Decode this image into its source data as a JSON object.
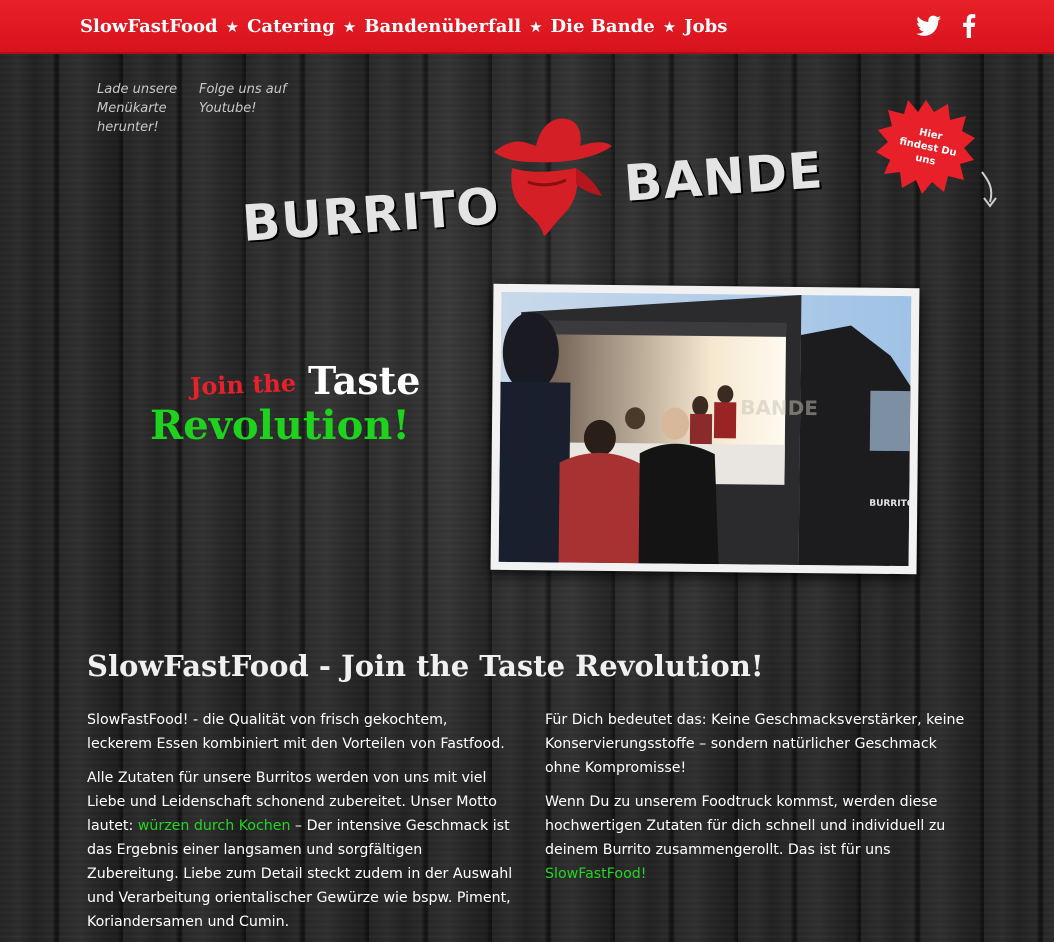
{
  "nav": {
    "items": [
      "SlowFastFood",
      "Catering",
      "Bandenüberfall",
      "Die Bande",
      "Jobs"
    ],
    "separator": "★"
  },
  "social": {
    "twitter": "twitter-icon",
    "facebook": "facebook-icon"
  },
  "header": {
    "menu_link": "Lade unsere Menükarte herunter!",
    "youtube_link": "Folge uns auf Youtube!",
    "starburst": "Hier findest Du uns"
  },
  "logo": {
    "word1": "BURRITO",
    "word2": "BANDE"
  },
  "slogan": {
    "part1": "Join the",
    "part2": "Taste",
    "part3": "Revolution!"
  },
  "photo": {
    "truck_text": "BANDE",
    "truck_text2": "BURRITO"
  },
  "content": {
    "title": "SlowFastFood - Join the Taste Revolution!",
    "left": {
      "p1": "SlowFastFood! - die Qualität von frisch gekochtem, leckerem Essen kombiniert mit den Vorteilen von Fastfood.",
      "p2_before": "Alle Zutaten für unsere Burritos werden von uns mit viel Liebe und Leidenschaft schonend zubereitet. Unser Motto lautet: ",
      "p2_link": "würzen durch Kochen",
      "p2_after": " – Der intensive Geschmack ist das Ergebnis einer langsamen und sorgfältigen Zubereitung. Liebe zum Detail steckt zudem in der Auswahl und Verarbeitung orientalischer Gewürze wie bspw. Piment, Koriandersamen und Cumin."
    },
    "right": {
      "p1": "Für Dich bedeutet das: Keine Geschmacksverstärker, keine Konservierungsstoffe – sondern natürlicher Geschmack ohne Kompromisse!",
      "p2_before": "Wenn Du zu unserem Foodtruck kommst, werden diese hochwertigen Zutaten für dich schnell und individuell zu deinem Burrito zusammengerollt. Das ist für uns ",
      "p2_link": "SlowFastFood!"
    }
  },
  "colors": {
    "nav_red": "#e8202a",
    "link_green": "#22d622",
    "slogan_green": "#1ed21e"
  }
}
